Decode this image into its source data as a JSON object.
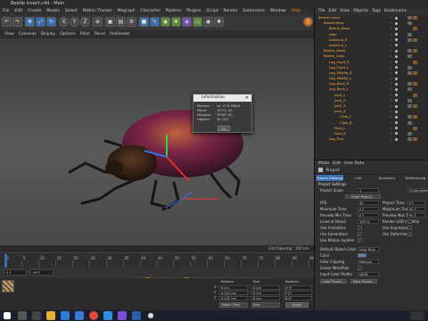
{
  "window": {
    "title": "Beetle Insect.c4d - Main"
  },
  "menu": [
    "File",
    "Edit",
    "Create",
    "Modes",
    "Select",
    "Motion Tracker",
    "Mograph",
    "Character",
    "Pipeline",
    "Plugins",
    "Script",
    "Render",
    "Extensions",
    "Window",
    "Help"
  ],
  "menu_highlight": 14,
  "toolbar_xyz": [
    "X",
    "Y",
    "Z"
  ],
  "viewport_tabs": [
    "View",
    "Cameras",
    "Display",
    "Options",
    "Filter",
    "Panel",
    "ProRender"
  ],
  "status": {
    "grid_spacing": "Grid Spacing : 100 cm"
  },
  "info_dialog": {
    "title": "Information",
    "rows": [
      {
        "k": "Memory",
        "v": "ca. 27.8 MByte"
      },
      {
        "k": "Points",
        "v": "19711 (0)"
      },
      {
        "k": "Polygons",
        "v": "19307 (0)"
      },
      {
        "k": "Objects",
        "v": "32 (32)"
      }
    ],
    "ok_label": "OK"
  },
  "object_manager": {
    "tabs": [
      "File",
      "Edit",
      "View",
      "Objects",
      "Tags",
      "Bookmarks"
    ],
    "rows": [
      {
        "label": "Beetle Insect",
        "indent": 0
      },
      {
        "label": "Beetle Body",
        "indent": 1
      },
      {
        "label": "Beetle_Base",
        "indent": 2
      },
      {
        "label": "Hide",
        "indent": 2
      },
      {
        "label": "Antenna_R",
        "indent": 2
      },
      {
        "label": "Antenna_L",
        "indent": 2
      },
      {
        "label": "Beetle_Head",
        "indent": 1
      },
      {
        "label": "Beetle_Legs",
        "indent": 1
      },
      {
        "label": "Leg_Front_R",
        "indent": 2
      },
      {
        "label": "Leg_Front_L",
        "indent": 2
      },
      {
        "label": "Leg_Middle_R",
        "indent": 2
      },
      {
        "label": "Leg_Middle_L",
        "indent": 2
      },
      {
        "label": "Leg_Back_R",
        "indent": 2
      },
      {
        "label": "Leg_Back_L",
        "indent": 2
      },
      {
        "label": "Joint_1",
        "indent": 3
      },
      {
        "label": "Joint_2",
        "indent": 3
      },
      {
        "label": "Joint_3",
        "indent": 3
      },
      {
        "label": "Joint_4",
        "indent": 3
      },
      {
        "label": "Claw_L",
        "indent": 4
      },
      {
        "label": "Claw_R",
        "indent": 4
      },
      {
        "label": "Foot_L",
        "indent": 3
      },
      {
        "label": "Foot_R",
        "indent": 3
      },
      {
        "label": "Leg_End",
        "indent": 2
      }
    ]
  },
  "attribute_manager": {
    "tabs": [
      "Mode",
      "Edit",
      "User Data"
    ],
    "section": "Project",
    "subtabs": [
      "Project Settings",
      "Info",
      "Dynamics",
      "Referencing"
    ],
    "header": "Project Settings",
    "rows_left": [
      {
        "k": "Project Scale",
        "v": "1"
      },
      {
        "k": "FPS",
        "v": "30"
      },
      {
        "k": "Minimum Time",
        "v": "0 F"
      },
      {
        "k": "Preview Min Time",
        "v": "0 F"
      },
      {
        "k": "Level of Detail",
        "v": "100 %"
      },
      {
        "k": "Use Animation",
        "v": ""
      },
      {
        "k": "Use Generators",
        "v": ""
      },
      {
        "k": "Use Motion System",
        "v": ""
      }
    ],
    "rows_right": [
      {
        "k": "Project Time",
        "v": "0 F"
      },
      {
        "k": "Maximum Time",
        "v": "90 F"
      },
      {
        "k": "Preview Max Time",
        "v": "90 F"
      },
      {
        "k": "Render LOD in Editor",
        "v": ""
      },
      {
        "k": "Use Expression",
        "v": ""
      },
      {
        "k": "Use Deformers",
        "v": ""
      }
    ],
    "unit": "Centimeters",
    "scale_btn": "Scale Project...",
    "rows_lower": [
      {
        "k": "Default Object Color",
        "v": "Gray Blue"
      },
      {
        "k": "Color",
        "v": ""
      },
      {
        "k": "View Clipping",
        "v": "Medium"
      },
      {
        "k": "Linear Workflow",
        "v": ""
      },
      {
        "k": "Input Color Profile",
        "v": "sRGB"
      }
    ],
    "buttons": [
      "Load Preset...",
      "Save Preset..."
    ]
  },
  "coords": {
    "headers": [
      "Position",
      "Size",
      "Rotation"
    ],
    "rows": [
      {
        "axis": "X",
        "p": "0 cm",
        "s": "0 cm",
        "r": "H 0°"
      },
      {
        "axis": "Y",
        "p": "0.041 cm",
        "s": "0 cm",
        "r": "P 0°"
      },
      {
        "axis": "Z",
        "p": "0.432 cm",
        "s": "0 cm",
        "r": "B 0°"
      }
    ],
    "mode": "Object (Rel)",
    "size_mode": "Size",
    "apply": "Apply"
  },
  "timeline": {
    "ticks": [
      "0",
      "5",
      "10",
      "15",
      "20",
      "25",
      "30",
      "35",
      "40",
      "45",
      "50",
      "55",
      "60",
      "65",
      "70",
      "75",
      "80",
      "85",
      "90"
    ],
    "start": "0 F",
    "end": "90 F"
  },
  "colors": {
    "accent": "#ff8a00",
    "blue": "#3b6fb3"
  }
}
